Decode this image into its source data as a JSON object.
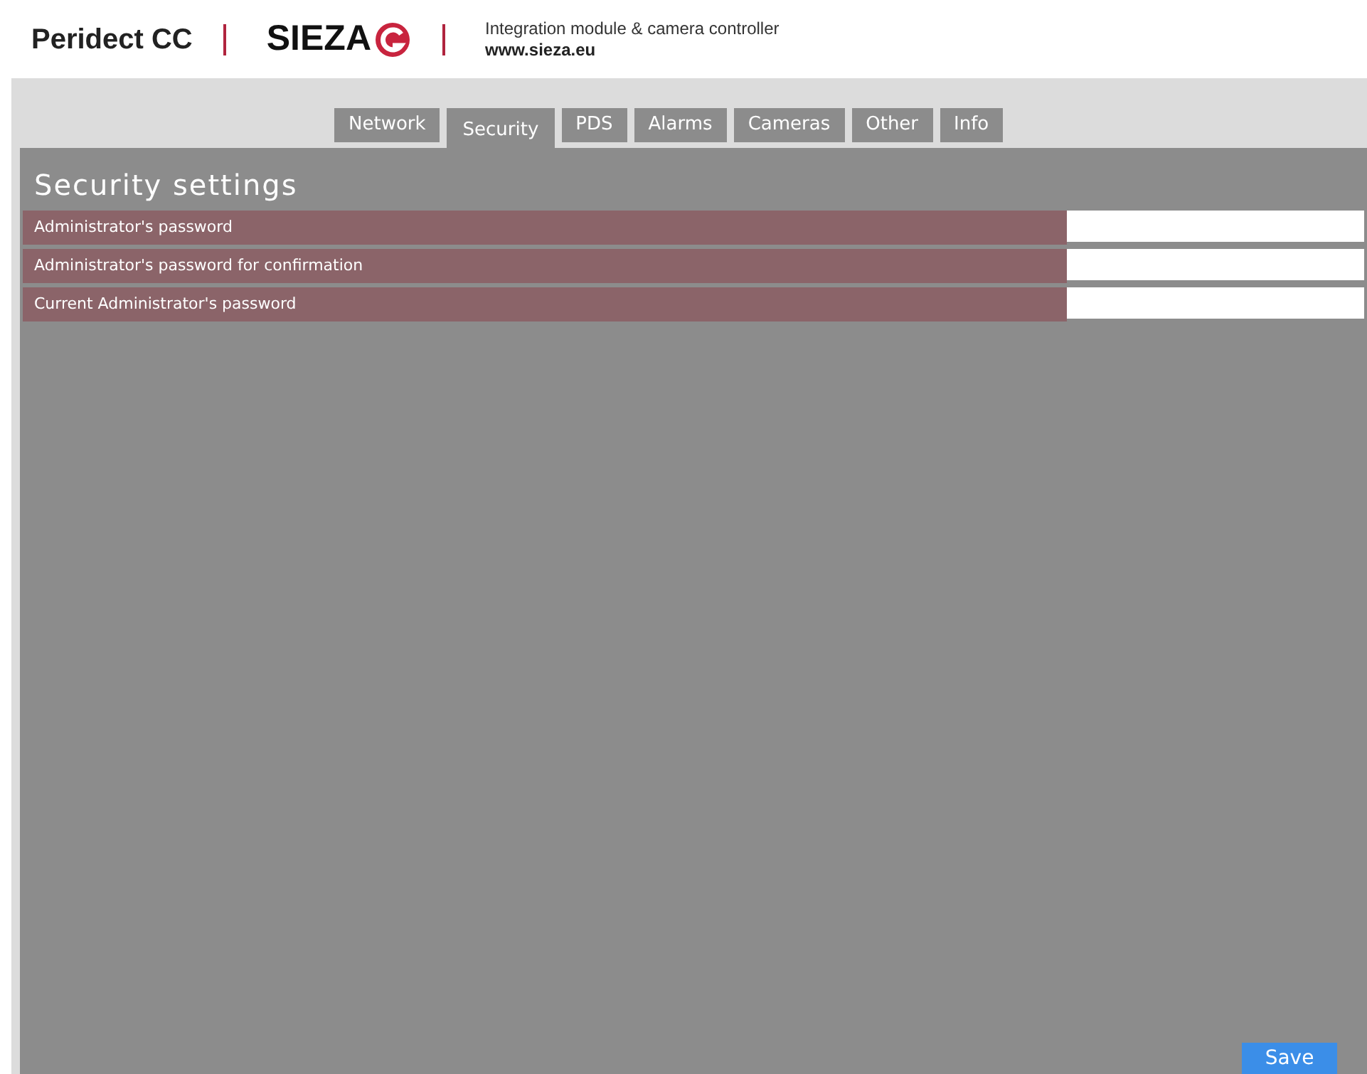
{
  "header": {
    "product": "Peridect CC",
    "brand": "SIEZA",
    "tagline": "Integration module & camera controller",
    "website": "www.sieza.eu"
  },
  "tabs": [
    {
      "label": "Network",
      "selected": false
    },
    {
      "label": "Security",
      "selected": true
    },
    {
      "label": "PDS",
      "selected": false
    },
    {
      "label": "Alarms",
      "selected": false
    },
    {
      "label": "Cameras",
      "selected": false
    },
    {
      "label": "Other",
      "selected": false
    },
    {
      "label": "Info",
      "selected": false
    }
  ],
  "panel": {
    "title": "Security settings",
    "fields": [
      {
        "label": "Administrator's password"
      },
      {
        "label": "Administrator's password for confirmation"
      },
      {
        "label": "Current Administrator's password"
      }
    ]
  },
  "buttons": [
    {
      "label": "Save"
    }
  ]
}
